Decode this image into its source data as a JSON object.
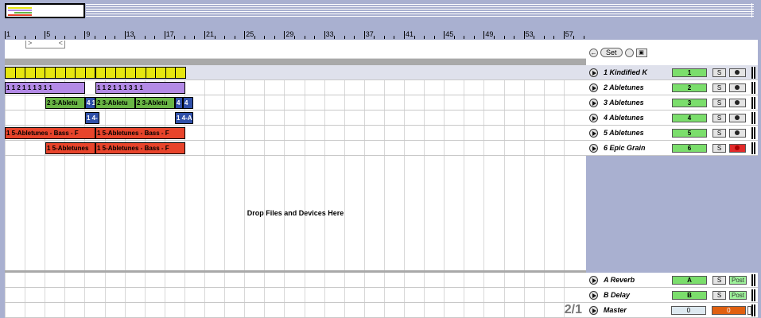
{
  "ruler": {
    "labels": [
      "1",
      "5",
      "9",
      "13",
      "17",
      "21",
      "25",
      "29",
      "33",
      "37",
      "41",
      "45",
      "49",
      "53",
      "57"
    ]
  },
  "loop_brace": {
    "left": ">",
    "right": "<"
  },
  "drop_text": "Drop Files and Devices Here",
  "time_signature": "2/1",
  "set_control": {
    "set_label": "Set"
  },
  "colors": {
    "yellow": "#e6e60f",
    "purple": "#b38ae6",
    "green": "#69b545",
    "blue": "#2f4fa8",
    "red": "#e8442b",
    "track_number_green": "#7bde6c",
    "arm_red": "#e32a2a",
    "cue_orange": "#e06010"
  },
  "tracks": [
    {
      "name": "1 Kindified K",
      "number": "1",
      "solo": "S",
      "armed": false,
      "selected": true,
      "clips": [
        {
          "label": "",
          "color": "yellow",
          "segments": 18,
          "start": 0,
          "width": 227
        }
      ]
    },
    {
      "name": "2 Abletunes",
      "number": "2",
      "solo": "S",
      "armed": false,
      "selected": false,
      "clips": [
        {
          "label": "1 1 2 1 1 1 3 1 1",
          "color": "purple",
          "start": 0,
          "width": 101
        },
        {
          "label": "1 1 2 1 1 1 3 1 1",
          "color": "purple",
          "start": 114,
          "width": 113
        }
      ]
    },
    {
      "name": "3 Abletunes",
      "number": "3",
      "solo": "S",
      "armed": false,
      "selected": false,
      "clips": [
        {
          "label": "2 3-Abletu",
          "color": "green",
          "start": 51,
          "width": 50
        },
        {
          "label": "4 1",
          "color": "blue",
          "start": 101,
          "width": 13
        },
        {
          "label": "2 3-Abletu",
          "color": "green",
          "start": 114,
          "width": 50
        },
        {
          "label": "2 3-Abletu",
          "color": "green",
          "start": 164,
          "width": 50
        },
        {
          "label": "4 1",
          "color": "blue",
          "start": 214,
          "width": 10
        },
        {
          "label": "4",
          "color": "blue",
          "start": 224,
          "width": 13
        }
      ]
    },
    {
      "name": "4 Abletunes",
      "number": "4",
      "solo": "S",
      "armed": false,
      "selected": false,
      "clips": [
        {
          "label": "1 4-",
          "color": "blue",
          "start": 101,
          "width": 18
        },
        {
          "label": "1 4-A",
          "color": "blue",
          "start": 214,
          "width": 23
        }
      ]
    },
    {
      "name": "5 Abletunes",
      "number": "5",
      "solo": "S",
      "armed": false,
      "selected": false,
      "clips": [
        {
          "label": "1 5-Abletunes - Bass - F",
          "color": "red",
          "start": 0,
          "width": 114
        },
        {
          "label": "1 5-Abletunes - Bass - F",
          "color": "red",
          "start": 114,
          "width": 113
        }
      ]
    },
    {
      "name": "6 Epic Grain",
      "number": "6",
      "solo": "S",
      "armed": true,
      "selected": false,
      "clips": [
        {
          "label": "1 5-Abletunes",
          "color": "red",
          "start": 51,
          "width": 63
        },
        {
          "label": "1 5-Abletunes - Bass - F",
          "color": "red",
          "start": 114,
          "width": 113
        }
      ]
    }
  ],
  "returns": [
    {
      "name": "A Reverb",
      "letter": "A",
      "solo": "S",
      "post": "Post"
    },
    {
      "name": "B Delay",
      "letter": "B",
      "solo": "S",
      "post": "Post"
    }
  ],
  "master": {
    "name": "Master",
    "volume": "0",
    "cue": "0"
  }
}
